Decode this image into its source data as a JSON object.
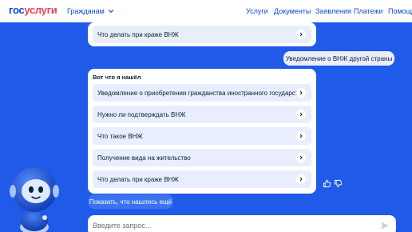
{
  "header": {
    "logo_part1": "гос",
    "logo_part2": "услуги",
    "citizens": "Гражданам",
    "nav": [
      "Услуги",
      "Документы",
      "Заявления",
      "Платежи",
      "Помощь"
    ]
  },
  "chat": {
    "top_item": "Что делать при краже ВНЖ",
    "user_message": "Уведомление о ВНЖ другой страны",
    "result_title": "Вот что я нашёл",
    "results": [
      "Уведомление о приобретении гражданства иностранного государства",
      "Нужно ли подтверждать ВНЖ",
      "Что такое ВНЖ",
      "Получение вида на жительство",
      "Что делать при краже ВНЖ"
    ],
    "show_more": "Показать, что нашлось ещё"
  },
  "input": {
    "placeholder": "Введите запрос..."
  },
  "colors": {
    "background": "#1f5ae8",
    "brand_blue": "#0d4cd3",
    "brand_red": "#ee3f58",
    "item_bg": "#e8eefb"
  },
  "icons": [
    "chevron-down-icon",
    "chevron-right-icon",
    "thumbs-up-icon",
    "thumbs-down-icon",
    "send-icon",
    "robot-assistant"
  ]
}
